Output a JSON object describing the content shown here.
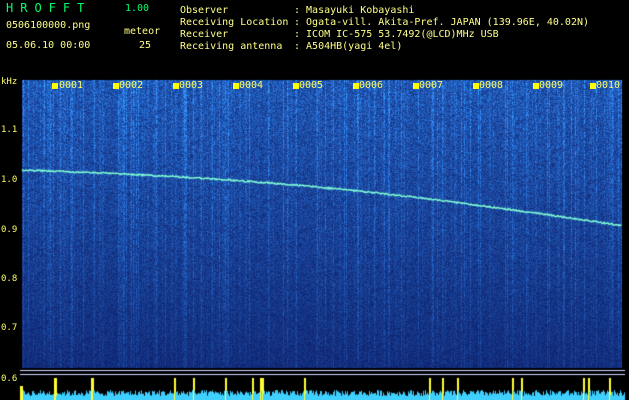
{
  "header": {
    "brand": "HROFFT",
    "version": "1.00",
    "filename": "0506100000.png",
    "datetime": "05.06.10 00:00",
    "meteor_label": "meteor",
    "meteor_count": "25",
    "fields": [
      {
        "label": "Observer",
        "value": ": Masayuki Kobayashi"
      },
      {
        "label": "Receiving Location",
        "value": ": Ogata-vill. Akita-Pref. JAPAN (139.96E, 40.02N)"
      },
      {
        "label": "Receiver",
        "value": ": ICOM IC-575 53.7492(@LCD)MHz USB"
      },
      {
        "label": "Receiving antenna",
        "value": ": A504HB(yagi 4el)"
      }
    ]
  },
  "axis": {
    "unit": "kHz",
    "ticks": [
      "1.1",
      "1.0",
      "0.9",
      "0.8",
      "0.7",
      "0.6"
    ]
  },
  "minutes": [
    "0001",
    "0002",
    "0003",
    "0004",
    "0005",
    "0006",
    "0007",
    "0008",
    "0009",
    "0010"
  ],
  "colors": {
    "background": "#000000",
    "text": "#ffff66",
    "brand": "#00ff66",
    "spectrum_low": "#0a1a70",
    "spectrum_high": "#3fa0ff",
    "carrier_line": "#7fffd4",
    "marker": "#ffff00"
  }
}
